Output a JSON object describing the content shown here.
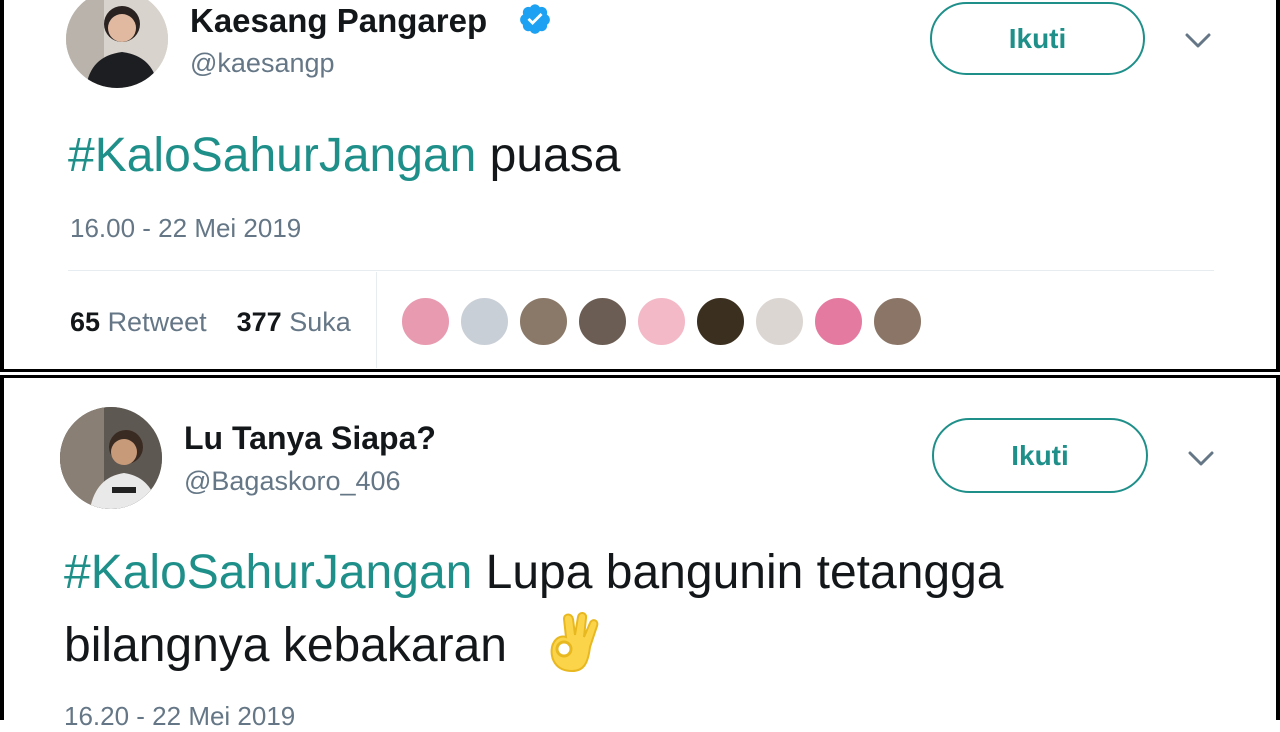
{
  "tweets": [
    {
      "author_name": "Kaesang Pangarep",
      "handle": "@kaesangp",
      "verified": true,
      "follow_label": "Ikuti",
      "hashtag": "#KaloSahurJangan",
      "text_line1": " puasa",
      "text_line2": "",
      "timestamp": "16.00 - 22 Mei 2019",
      "retweet_count": "65",
      "retweet_label": "Retweet",
      "like_count": "377",
      "like_label": "Suka",
      "liker_avatar_colors": [
        "#e79ab0",
        "#c9cfd6",
        "#8a7868",
        "#6b5d54",
        "#f3b9c7",
        "#3b2f1f",
        "#dcd6d2",
        "#e57aa0",
        "#8b7566"
      ]
    },
    {
      "author_name": "Lu Tanya Siapa?",
      "handle": "@Bagaskoro_406",
      "verified": false,
      "follow_label": "Ikuti",
      "hashtag": "#KaloSahurJangan",
      "text_line1": " Lupa bangunin tetangga",
      "text_line2": "bilangnya kebakaran",
      "emoji": "ok-hand-emoji",
      "timestamp": "16.20 - 22 Mei 2019"
    }
  ],
  "colors": {
    "hashtag": "#1f8f8a",
    "follow_border": "#1f8f8a",
    "verified_badge": "#1da1f2",
    "muted_text": "#657786"
  }
}
